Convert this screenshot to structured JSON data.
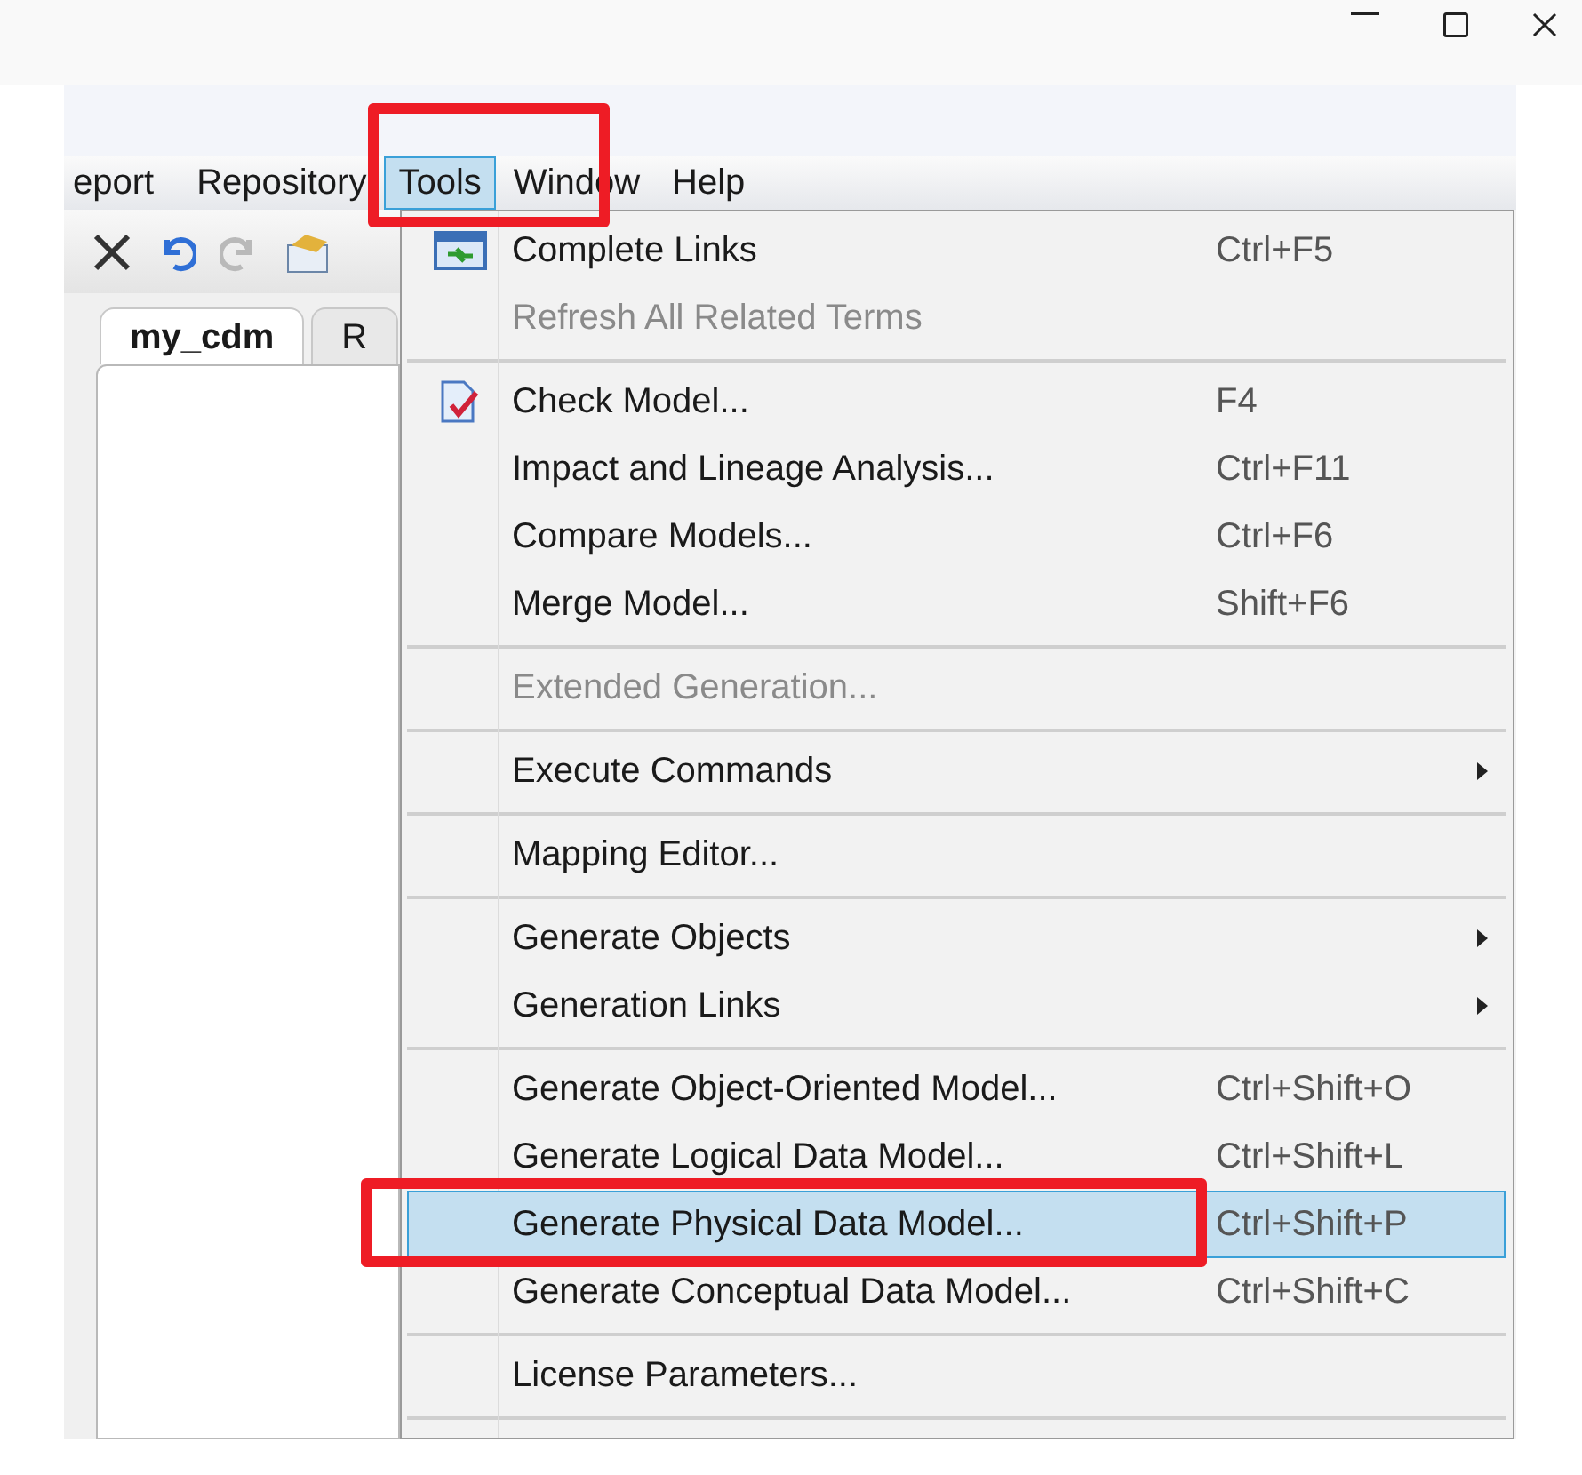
{
  "menubar": [
    {
      "label": "eport",
      "selected": false
    },
    {
      "label": "Repository",
      "selected": false
    },
    {
      "label": "Tools",
      "selected": true
    },
    {
      "label": "Window",
      "selected": false
    },
    {
      "label": "Help",
      "selected": false
    }
  ],
  "document_tabs": [
    {
      "label": "my_cdm",
      "selected": true
    },
    {
      "label": "R",
      "selected": false
    }
  ],
  "menu": [
    {
      "kind": "item",
      "label": "Complete Links",
      "shortcut": "Ctrl+F5",
      "disabled": false,
      "selected": false,
      "submenu": false
    },
    {
      "kind": "item",
      "label": "Refresh All Related Terms",
      "disabled": true,
      "selected": false,
      "submenu": false
    },
    {
      "kind": "separator"
    },
    {
      "kind": "item",
      "label": "Check Model...",
      "shortcut": "F4",
      "disabled": false,
      "selected": false,
      "submenu": false
    },
    {
      "kind": "item",
      "label": "Impact and Lineage Analysis...",
      "shortcut": "Ctrl+F11",
      "disabled": false,
      "selected": false,
      "submenu": false
    },
    {
      "kind": "item",
      "label": "Compare Models...",
      "shortcut": "Ctrl+F6",
      "disabled": false,
      "selected": false,
      "submenu": false
    },
    {
      "kind": "item",
      "label": "Merge Model...",
      "shortcut": "Shift+F6",
      "disabled": false,
      "selected": false,
      "submenu": false
    },
    {
      "kind": "separator"
    },
    {
      "kind": "item",
      "label": "Extended Generation...",
      "disabled": true,
      "selected": false,
      "submenu": false
    },
    {
      "kind": "separator"
    },
    {
      "kind": "item",
      "label": "Execute Commands",
      "disabled": false,
      "selected": false,
      "submenu": true
    },
    {
      "kind": "separator"
    },
    {
      "kind": "item",
      "label": "Mapping Editor...",
      "disabled": false,
      "selected": false,
      "submenu": false
    },
    {
      "kind": "separator"
    },
    {
      "kind": "item",
      "label": "Generate Objects",
      "disabled": false,
      "selected": false,
      "submenu": true
    },
    {
      "kind": "item",
      "label": "Generation Links",
      "disabled": false,
      "selected": false,
      "submenu": true
    },
    {
      "kind": "separator"
    },
    {
      "kind": "item",
      "label": "Generate Object-Oriented Model...",
      "shortcut": "Ctrl+Shift+O",
      "disabled": false,
      "selected": false,
      "submenu": false
    },
    {
      "kind": "item",
      "label": "Generate Logical Data Model...",
      "shortcut": "Ctrl+Shift+L",
      "disabled": false,
      "selected": false,
      "submenu": false
    },
    {
      "kind": "item",
      "label": "Generate Physical Data Model...",
      "shortcut": "Ctrl+Shift+P",
      "disabled": false,
      "selected": true,
      "submenu": false
    },
    {
      "kind": "item",
      "label": "Generate Conceptual Data Model...",
      "shortcut": "Ctrl+Shift+C",
      "disabled": false,
      "selected": false,
      "submenu": false
    },
    {
      "kind": "separator"
    },
    {
      "kind": "item",
      "label": "License Parameters...",
      "disabled": false,
      "selected": false,
      "submenu": false
    },
    {
      "kind": "separator"
    }
  ]
}
